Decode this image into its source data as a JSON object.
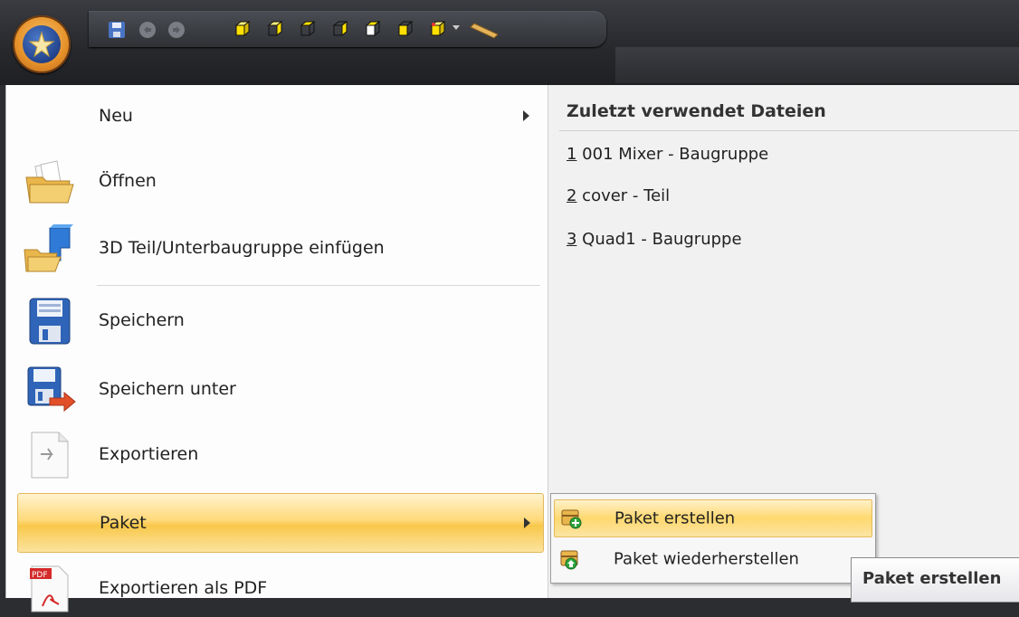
{
  "menu": {
    "items": [
      {
        "label": "Neu",
        "icon": "none",
        "submenu": true
      },
      {
        "label": "Öffnen",
        "icon": "open-folder-icon"
      },
      {
        "label": "3D Teil/Unterbaugruppe einfügen",
        "icon": "insert-part-icon"
      },
      {
        "label": "Speichern",
        "icon": "save-icon"
      },
      {
        "label": "Speichern unter",
        "icon": "save-as-icon"
      },
      {
        "label": "Exportieren",
        "icon": "export-icon"
      },
      {
        "label": "Paket",
        "icon": "none",
        "submenu": true,
        "highlighted": true
      },
      {
        "label": "Exportieren als PDF",
        "icon": "pdf-icon"
      }
    ]
  },
  "recent": {
    "title": "Zuletzt verwendet Dateien",
    "files": [
      {
        "num": "1",
        "name": " 001 Mixer - Baugruppe"
      },
      {
        "num": "2",
        "name": " cover - Teil"
      },
      {
        "num": "3",
        "name": " Quad1 - Baugruppe"
      }
    ]
  },
  "submenu": {
    "items": [
      {
        "label": "Paket erstellen",
        "icon": "package-create-icon",
        "highlighted": true
      },
      {
        "label": "Paket wiederherstellen",
        "icon": "package-restore-icon"
      }
    ]
  },
  "tooltip": "Paket erstellen",
  "colors": {
    "highlight": "#ffd97a",
    "toolbar": "#2b2d31"
  }
}
